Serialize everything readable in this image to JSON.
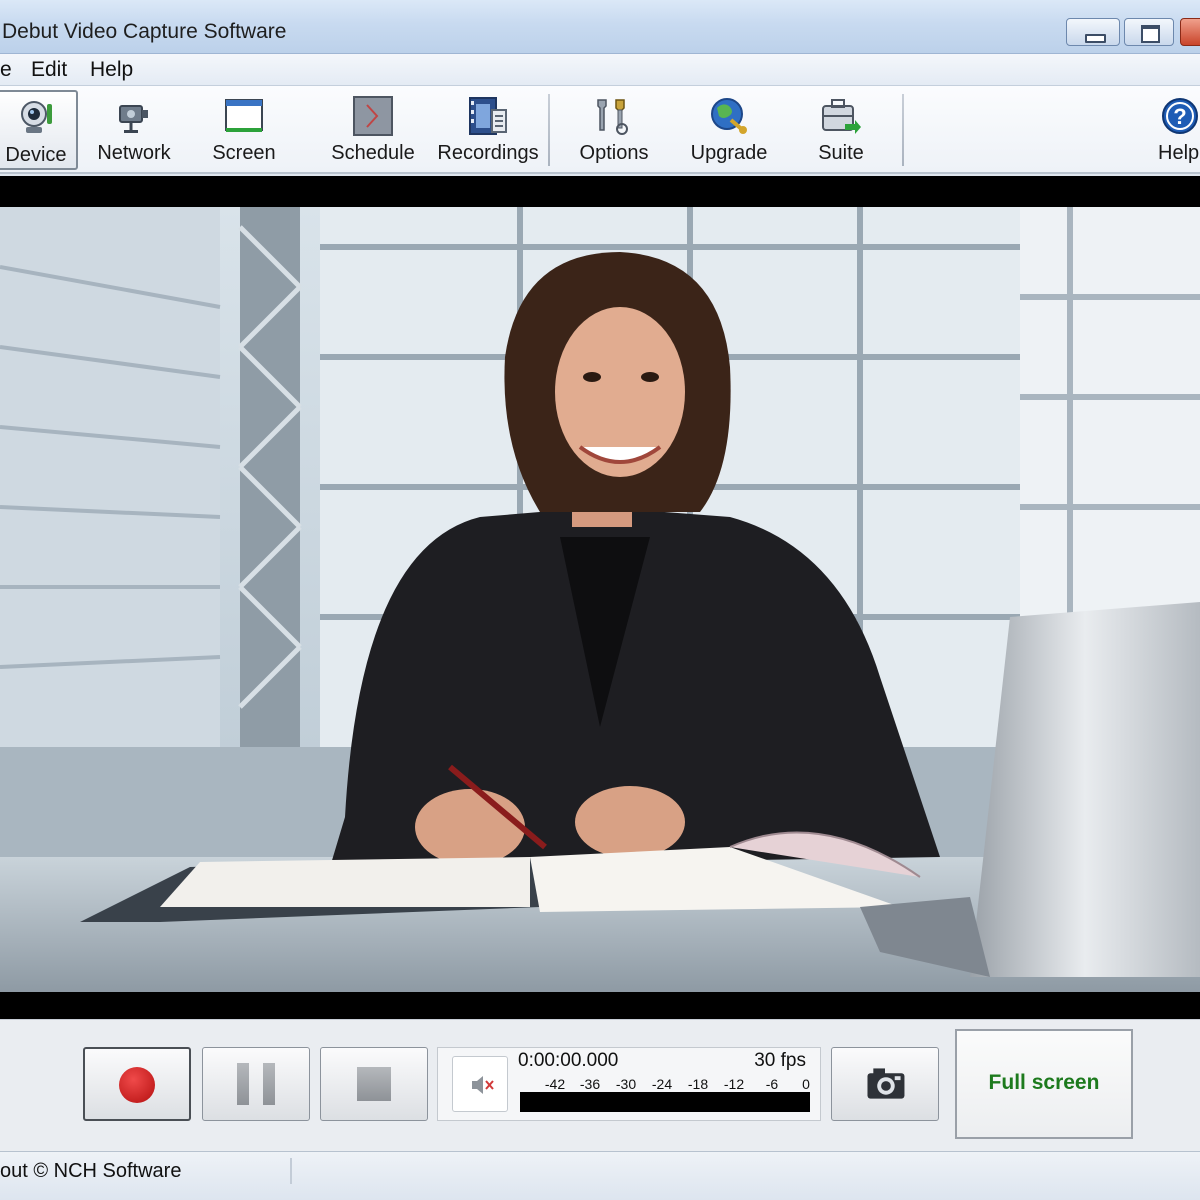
{
  "window": {
    "title": "Debut Video Capture Software"
  },
  "menu": {
    "file": "e",
    "edit": "Edit",
    "help": "Help"
  },
  "toolbar": {
    "device": "Device",
    "network": "Network",
    "screen": "Screen",
    "schedule": "Schedule",
    "recordings": "Recordings",
    "options": "Options",
    "upgrade": "Upgrade",
    "suite": "Suite",
    "help": "Help"
  },
  "controls": {
    "timecode": "0:00:00.000",
    "fps": "30 fps",
    "level_scale": [
      "-42",
      "-36",
      "-30",
      "-24",
      "-18",
      "-12",
      "-6",
      "0"
    ],
    "fullscreen_label": "Full screen"
  },
  "status": {
    "text": "out © NCH Software"
  },
  "colors": {
    "record": "#cc1a1a",
    "fullscreen_text": "#1d7a1d"
  }
}
